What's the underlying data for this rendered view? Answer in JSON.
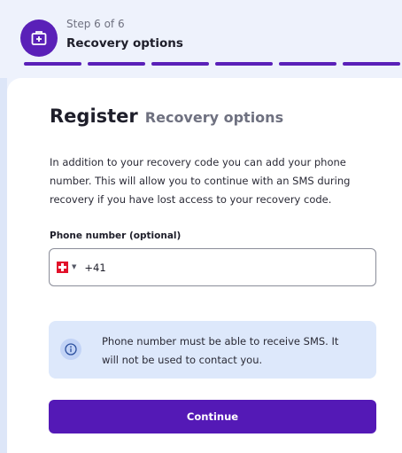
{
  "header": {
    "step_label": "Step 6 of 6",
    "step_title": "Recovery options",
    "step_icon": "medical-kit-icon",
    "progress": {
      "current": 6,
      "total": 6
    }
  },
  "main": {
    "heading": "Register",
    "subheading": "Recovery options",
    "description": "In addition to your recovery code you can add your phone number. This will allow you to continue with an SMS during recovery if you have lost access to your recovery code.",
    "phone_field": {
      "label": "Phone number (optional)",
      "country_flag": "switzerland-flag-icon",
      "value": "+41",
      "placeholder": ""
    },
    "info": {
      "icon": "info-icon",
      "text": "Phone number must be able to receive SMS. It will not be used to contact you."
    },
    "continue_label": "Continue"
  },
  "colors": {
    "accent": "#5419b6",
    "info_background": "#dde8fb",
    "page_background": "#eef2fc",
    "flag_red": "#e2112a"
  }
}
